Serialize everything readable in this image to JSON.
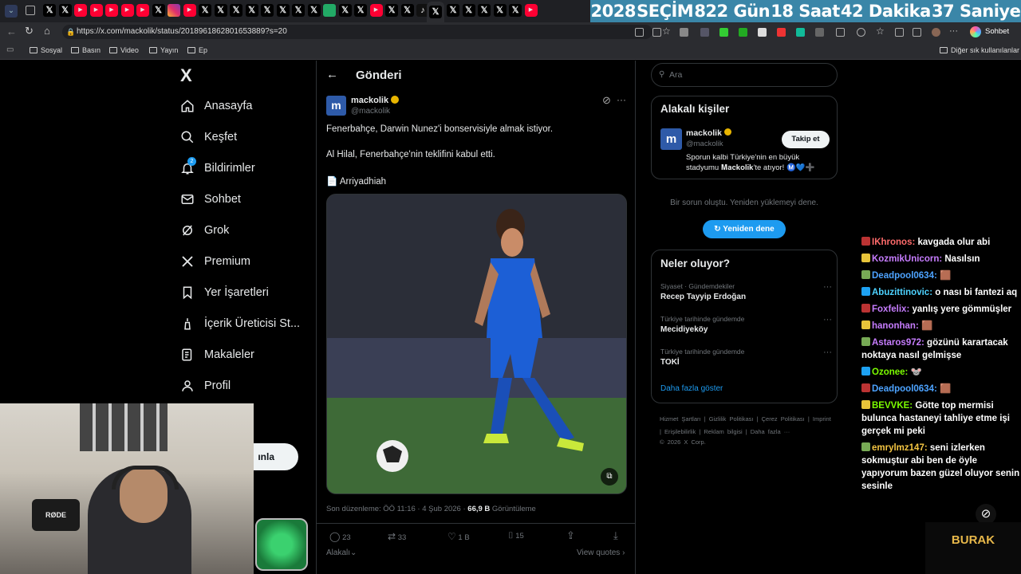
{
  "countdown": {
    "year": "2028",
    "label": "SEÇİM",
    "days": "822 Gün",
    "hours": "18 Saat",
    "minutes": "42 Dakika",
    "seconds": "37 Saniye"
  },
  "browser": {
    "url": "https://x.com/mackolik/status/2018961862801653889?s=20",
    "chat_button": "Sohbet et",
    "bookmarks": [
      "Sosyal",
      "Basın",
      "Video",
      "Yayın",
      "Ep"
    ],
    "other_bookmarks": "Diğer sık kullanılanlar"
  },
  "nav": {
    "logo": "X",
    "items": [
      {
        "label": "Anasayfa",
        "icon": "home-icon"
      },
      {
        "label": "Keşfet",
        "icon": "search-icon"
      },
      {
        "label": "Bildirimler",
        "icon": "bell-icon",
        "badge": "2"
      },
      {
        "label": "Sohbet",
        "icon": "mail-icon"
      },
      {
        "label": "Grok",
        "icon": "grok-icon"
      },
      {
        "label": "Premium",
        "icon": "x-icon"
      },
      {
        "label": "Yer İşaretleri",
        "icon": "bookmark-icon"
      },
      {
        "label": "İçerik Üreticisi St...",
        "icon": "creator-icon"
      },
      {
        "label": "Makaleler",
        "icon": "article-icon"
      },
      {
        "label": "Profil",
        "icon": "profile-icon"
      }
    ],
    "post_button_partial": "ınla"
  },
  "post": {
    "header": "Gönderi",
    "author_name": "mackolik",
    "author_handle": "@mackolik",
    "text1": "Fenerbahçe, Darwin Nunez'i bonservisiyle almak istiyor.",
    "text2": "Al Hilal, Fenerbahçe'nin teklifini kabul etti.",
    "source": "📄 Arriyadhiah",
    "edited": "Son düzenleme: ÖÖ 11:16 · 4 Şub 2026 · ",
    "views_count": "66,9 B",
    "views_label": " Görüntüleme",
    "replies": "23",
    "reposts": "33",
    "likes": "1 B",
    "bookmarks": "15",
    "related": "Alakalı",
    "view_quotes": "View quotes"
  },
  "right": {
    "search_placeholder": "Ara",
    "relevant_title": "Alakalı kişiler",
    "person_name": "mackolik",
    "person_handle": "@mackolik",
    "follow_button": "Takip et",
    "person_bio": "Sporun kalbi Türkiye'nin en büyük stadyumu 𝐌𝐚𝐜𝐤𝐨𝐥𝐢𝐤'te atıyor! Ⓜ️💙➕",
    "error_text": "Bir sorun oluştu. Yeniden yüklemeyi dene.",
    "retry_button": "Yeniden dene",
    "trends_title": "Neler oluyor?",
    "trends": [
      {
        "category": "Siyaset · Gündemdekiler",
        "name": "Recep Tayyip Erdoğan"
      },
      {
        "category": "Türkiye tarihinde gündemde",
        "name": "Mecidiyeköy"
      },
      {
        "category": "Türkiye tarihinde gündemde",
        "name": "TOKİ"
      }
    ],
    "show_more": "Daha fazla göster",
    "footer_links": [
      "Hizmet Şartları",
      "|",
      "Gizlilik Politikası",
      "|",
      "Çerez Politikası",
      "|",
      "Imprint",
      "|",
      "Erişilebilirlik",
      "|",
      "Reklam bilgisi",
      "|",
      "Daha fazla ···"
    ],
    "copyright": "© 2026 X Corp."
  },
  "chat": [
    {
      "user": "IKhronos:",
      "color": "#ff6b6b",
      "msg": "kavgada olur abi"
    },
    {
      "user": "KozmikUnicorn:",
      "color": "#c77dff",
      "msg": "Nasılsın"
    },
    {
      "user": "Deadpool0634:",
      "color": "#4da3ff",
      "msg": "🟫"
    },
    {
      "user": "Abuzittinovic:",
      "color": "#4dd2ff",
      "msg": "o nası bi fantezi aq"
    },
    {
      "user": "Foxfelix:",
      "color": "#c77dff",
      "msg": "yanlış yere gömmüşler"
    },
    {
      "user": "hanonhan:",
      "color": "#c77dff",
      "msg": "🟫"
    },
    {
      "user": "Astaros972:",
      "color": "#c77dff",
      "msg": "gözünü karartacak noktaya nasıl gelmişse"
    },
    {
      "user": "Ozonee:",
      "color": "#7CFC00",
      "msg": "🐭"
    },
    {
      "user": "Deadpool0634:",
      "color": "#4da3ff",
      "msg": "🟫"
    },
    {
      "user": "BEVVKE:",
      "color": "#7CFC00",
      "msg": "Götte top mermisi bulunca hastaneyi tahliye etme işi gerçek mi peki"
    },
    {
      "user": "emrylmz147:",
      "color": "#f4c542",
      "msg": "seni izlerken sokmuştur abi ben de öyle yapıyorum bazen güzel oluyor senin sesinle"
    }
  ],
  "overlay": {
    "mic_brand": "RØDE",
    "streamer_tag": "BURAK"
  }
}
